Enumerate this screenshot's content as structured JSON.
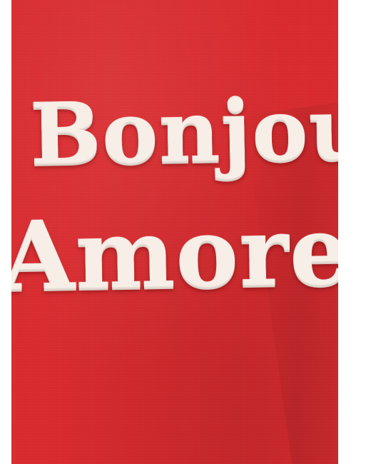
{
  "image": {
    "embroidered_text": {
      "line_1": "Bonjou",
      "line_2": "Amore"
    },
    "colors": {
      "fabric": "#d92b2f",
      "embroidery": "#f6eee7",
      "background": "#ffffff"
    }
  }
}
